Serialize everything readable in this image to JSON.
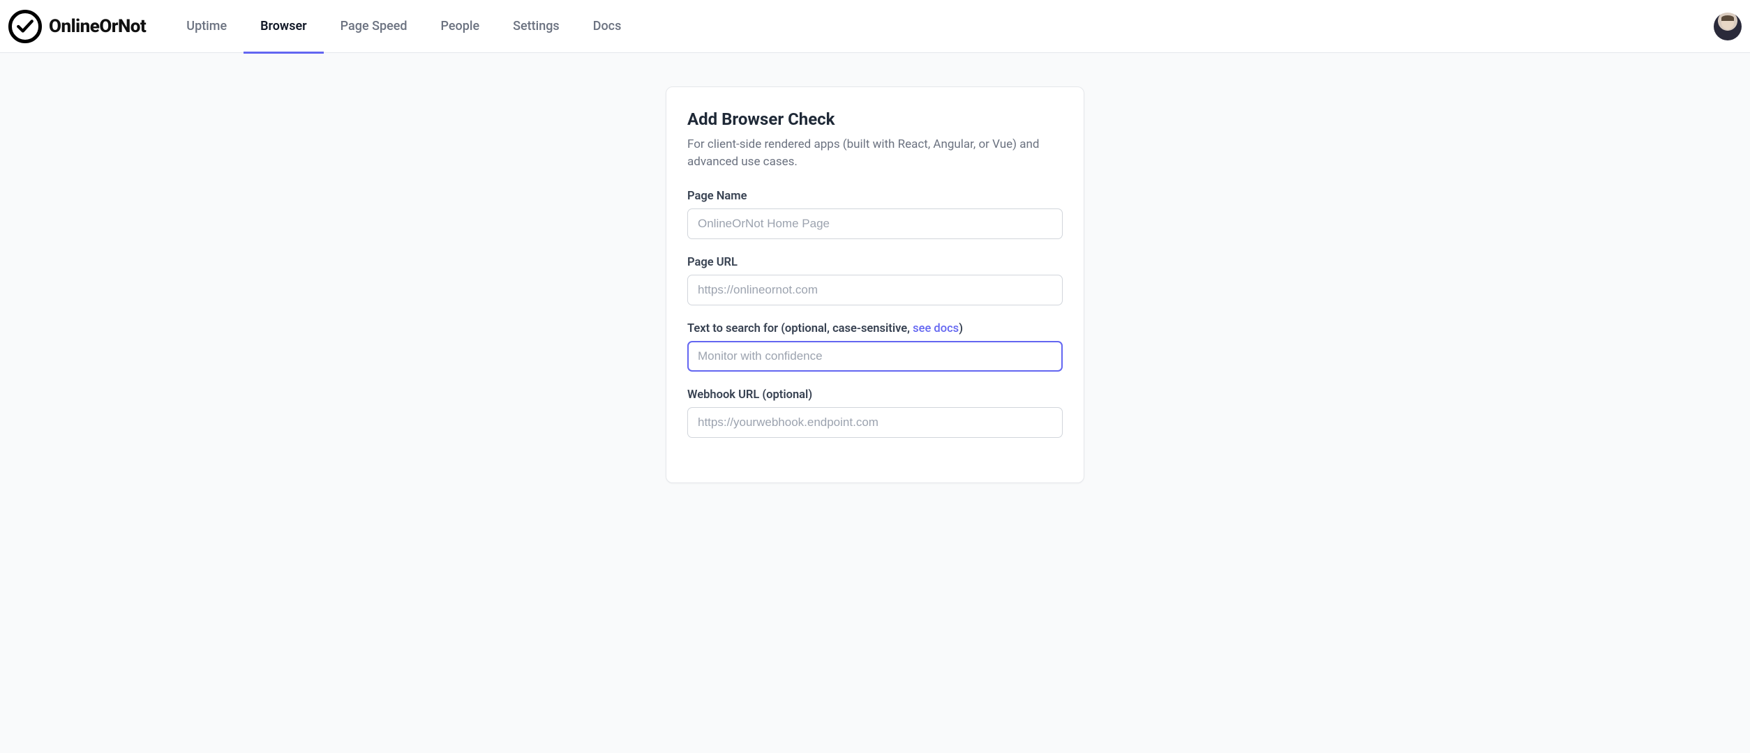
{
  "brand": "OnlineOrNot",
  "nav": {
    "items": [
      {
        "label": "Uptime",
        "active": false
      },
      {
        "label": "Browser",
        "active": true
      },
      {
        "label": "Page Speed",
        "active": false
      },
      {
        "label": "People",
        "active": false
      },
      {
        "label": "Settings",
        "active": false
      },
      {
        "label": "Docs",
        "active": false
      }
    ]
  },
  "form": {
    "title": "Add Browser Check",
    "subtitle": "For client-side rendered apps (built with React, Angular, or Vue) and advanced use cases.",
    "page_name": {
      "label": "Page Name",
      "placeholder": "OnlineOrNot Home Page",
      "value": ""
    },
    "page_url": {
      "label": "Page URL",
      "placeholder": "https://onlineornot.com",
      "value": ""
    },
    "search_text": {
      "label_prefix": "Text to search for (optional, case-sensitive, ",
      "label_link": "see docs",
      "label_suffix": ")",
      "placeholder": "Monitor with confidence",
      "value": ""
    },
    "webhook": {
      "label": "Webhook URL (optional)",
      "placeholder": "https://yourwebhook.endpoint.com",
      "value": ""
    }
  }
}
